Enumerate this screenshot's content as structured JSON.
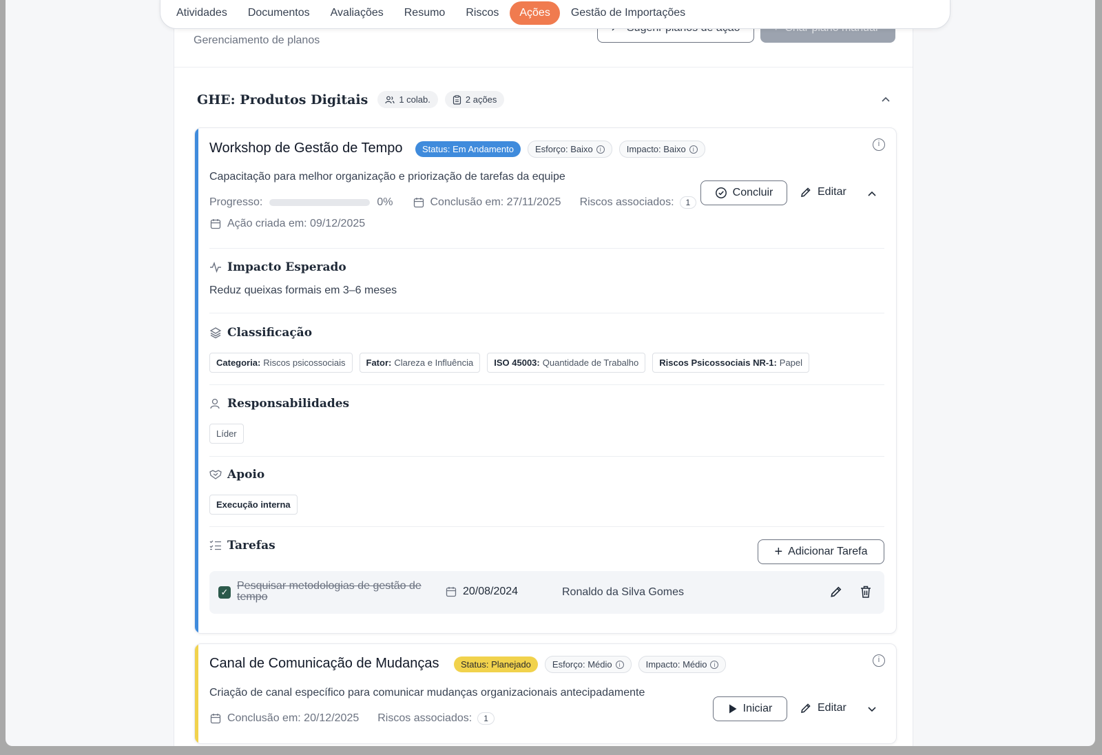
{
  "tabs": [
    "Atividades",
    "Documentos",
    "Avaliações",
    "Resumo",
    "Riscos",
    "Ações",
    "Gestão de Importações"
  ],
  "active_tab": "Ações",
  "header": {
    "subtitle": "Gerenciamento de planos",
    "suggest_label": "Sugerir planos de ação",
    "create_label": "Criar plano manual"
  },
  "ghe": {
    "title": "GHE: Produtos Digitais",
    "collab": "1 colab.",
    "actions": "2 ações"
  },
  "card1": {
    "title": "Workshop de Gestão de Tempo",
    "status": "Status: Em Andamento",
    "effort": "Esforço: Baixo",
    "impact": "Impacto: Baixo",
    "description": "Capacitação para melhor organização e priorização de tarefas da equipe",
    "progress_label": "Progresso:",
    "progress_value": "0%",
    "progress_fraction": 0,
    "conclusion": "Conclusão em: 27/11/2025",
    "risks_label": "Riscos associados:",
    "risks_count": "1",
    "created": "Ação criada em: 09/12/2025",
    "conclude_label": "Concluir",
    "edit_label": "Editar",
    "impact_title": "Impacto Esperado",
    "impact_text": "Reduz queixas formais em 3–6 meses",
    "class_title": "Classificação",
    "class_tags": [
      {
        "key": "Categoria:",
        "value": "Riscos psicossociais"
      },
      {
        "key": "Fator:",
        "value": "Clareza e Influência"
      },
      {
        "key": "ISO 45003:",
        "value": "Quantidade de Trabalho"
      },
      {
        "key": "Riscos Psicossociais NR-1:",
        "value": "Papel"
      }
    ],
    "resp_title": "Responsabilidades",
    "resp_tag": "Líder",
    "support_title": "Apoio",
    "support_tag": "Execução interna",
    "tasks_title": "Tarefas",
    "add_task_label": "Adicionar Tarefa",
    "task": {
      "name": "Pesquisar metodologias de gestão de tempo",
      "date": "20/08/2024",
      "user": "Ronaldo da Silva Gomes"
    }
  },
  "card2": {
    "title": "Canal de Comunicação de Mudanças",
    "status": "Status: Planejado",
    "effort": "Esforço: Médio",
    "impact": "Impacto: Médio",
    "description": "Criação de canal específico para comunicar mudanças organizacionais antecipadamente",
    "conclusion": "Conclusão em: 20/12/2025",
    "risks_label": "Riscos associados:",
    "risks_count": "1",
    "start_label": "Iniciar",
    "edit_label": "Editar"
  },
  "colors": {
    "accent": "#f07b4f",
    "status_in_progress": "#3f8bdc",
    "status_planned": "#f1d24c",
    "checkbox": "#2c5a4b"
  }
}
